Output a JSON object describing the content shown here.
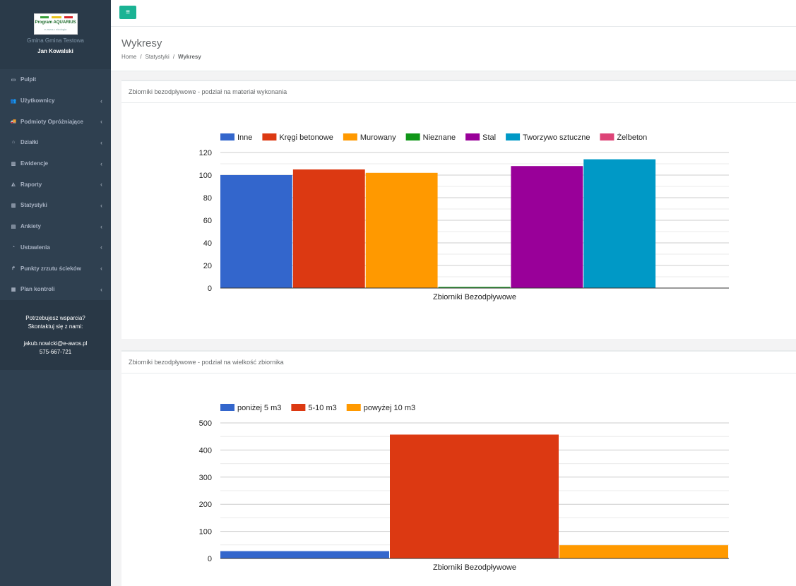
{
  "sidebar": {
    "logo_text": "Program AQUARIUS",
    "logo_sub": "e-awos • ekologia",
    "gmina": "Gmina Gmina Testowa",
    "user": "Jan Kowalski",
    "items": [
      {
        "label": "Pulpit",
        "icon": "desktop-icon",
        "glyph": "▭",
        "chevron": false
      },
      {
        "label": "Użytkownicy",
        "icon": "users-icon",
        "glyph": "👥",
        "chevron": true
      },
      {
        "label": "Podmioty Opróżniające",
        "icon": "truck-icon",
        "glyph": "🚚",
        "chevron": true
      },
      {
        "label": "Działki",
        "icon": "home-icon",
        "glyph": "⌂",
        "chevron": true
      },
      {
        "label": "Ewidencje",
        "icon": "bar-chart-icon",
        "glyph": "▥",
        "chevron": true
      },
      {
        "label": "Raporty",
        "icon": "area-chart-icon",
        "glyph": "◭",
        "chevron": true
      },
      {
        "label": "Statystyki",
        "icon": "bar-chart-icon",
        "glyph": "▥",
        "chevron": true
      },
      {
        "label": "Ankiety",
        "icon": "file-icon",
        "glyph": "▤",
        "chevron": true
      },
      {
        "label": "Ustawienia",
        "icon": "dashboard-icon",
        "glyph": "◔",
        "chevron": true
      },
      {
        "label": "Punkty zrzutu ścieków",
        "icon": "level-up-icon",
        "glyph": "↱",
        "chevron": true
      },
      {
        "label": "Plan kontroli",
        "icon": "calendar-icon",
        "glyph": "▦",
        "chevron": true
      }
    ],
    "support": {
      "line1": "Potrzebujesz wsparcia?",
      "line2": "Skontaktuj się z nami:",
      "email": "jakub.nowicki@e-awos.pl",
      "phone": "575-667-721"
    }
  },
  "topbar": {
    "menu_icon": "hamburger-icon",
    "menu_glyph": "≡"
  },
  "page": {
    "title": "Wykresy",
    "breadcrumb": [
      "Home",
      "Statystyki",
      "Wykresy"
    ]
  },
  "colors": {
    "accent": "#1ab394",
    "sidebar": "#2f4050"
  },
  "chart_data": [
    {
      "panel_title": "Zbiorniki bezodpływowe - podział na materiał wykonania",
      "type": "bar",
      "categories": [
        "Zbiorniki Bezodpływowe"
      ],
      "ylim": [
        0,
        120
      ],
      "yticks": [
        0,
        20,
        40,
        60,
        80,
        100,
        120
      ],
      "legend_position": "top",
      "grid": true,
      "series": [
        {
          "name": "Inne",
          "color": "#3366cc",
          "values": [
            100
          ]
        },
        {
          "name": "Kręgi betonowe",
          "color": "#dc3912",
          "values": [
            105
          ]
        },
        {
          "name": "Murowany",
          "color": "#ff9900",
          "values": [
            102
          ]
        },
        {
          "name": "Nieznane",
          "color": "#109618",
          "values": [
            1
          ]
        },
        {
          "name": "Stal",
          "color": "#990099",
          "values": [
            108
          ]
        },
        {
          "name": "Tworzywo sztuczne",
          "color": "#0099c6",
          "values": [
            114
          ]
        },
        {
          "name": "Żelbeton",
          "color": "#dd4477",
          "values": [
            0
          ]
        }
      ]
    },
    {
      "panel_title": "Zbiorniki bezodpływowe - podział na wielkość zbiornika",
      "type": "bar",
      "categories": [
        "Zbiorniki Bezodpływowe"
      ],
      "ylim": [
        0,
        500
      ],
      "yticks": [
        0,
        100,
        200,
        300,
        400,
        500
      ],
      "legend_position": "top",
      "grid": true,
      "series": [
        {
          "name": "poniżej 5 m3",
          "color": "#3366cc",
          "values": [
            27
          ]
        },
        {
          "name": "5-10 m3",
          "color": "#dc3912",
          "values": [
            457
          ]
        },
        {
          "name": "powyżej 10 m3",
          "color": "#ff9900",
          "values": [
            49
          ]
        }
      ]
    }
  ]
}
